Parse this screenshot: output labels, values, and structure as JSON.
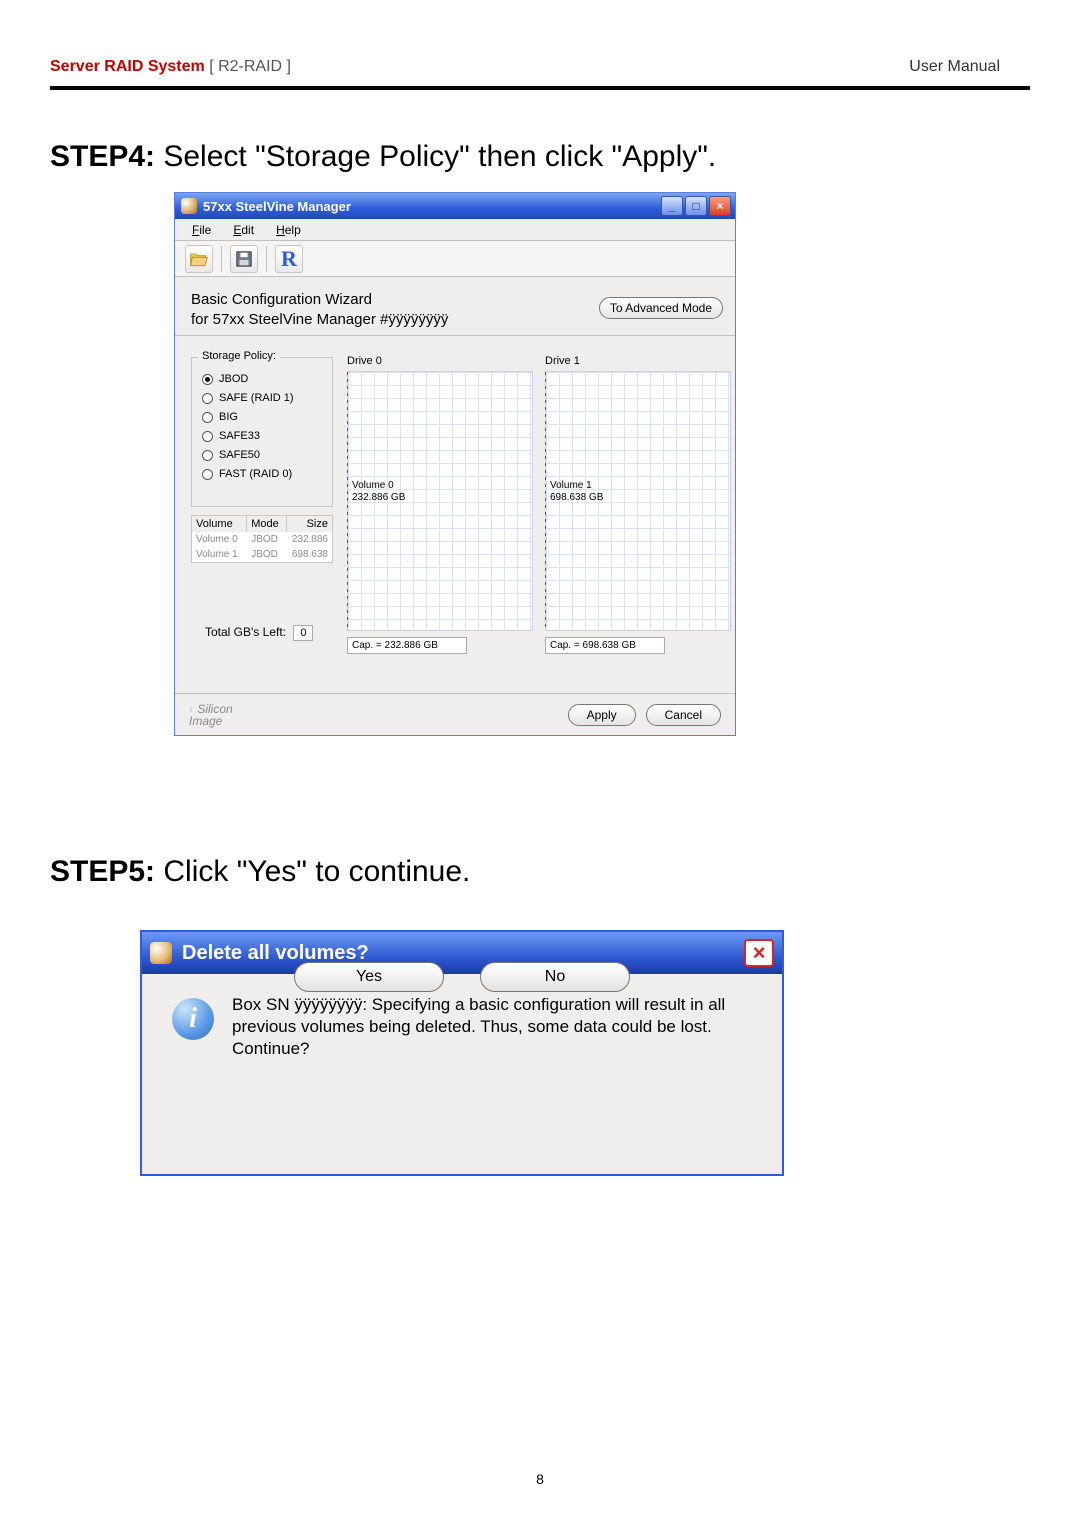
{
  "header": {
    "left_bold": "Server RAID System",
    "left_rest": " [ R2-RAID ]",
    "right": "User Manual"
  },
  "step4": {
    "bold": "STEP4:",
    "rest": " Select \"Storage Policy\" then click \"Apply\"."
  },
  "win1": {
    "title": "57xx SteelVine Manager",
    "min": "_",
    "max": "□",
    "close": "×",
    "menu": {
      "file_u": "F",
      "file_r": "ile",
      "edit_u": "E",
      "edit_r": "dit",
      "help_u": "H",
      "help_r": "elp"
    },
    "toolbar_r": "R",
    "wiz_title": "Basic Configuration Wizard",
    "wiz_sub": "for 57xx SteelVine Manager #ÿÿÿÿÿÿÿÿ",
    "adv": "To Advanced Mode",
    "policy_legend": "Storage Policy:",
    "policies": {
      "p0": "JBOD",
      "p1": "SAFE (RAID 1)",
      "p2": "BIG",
      "p3": "SAFE33",
      "p4": "SAFE50",
      "p5": "FAST (RAID 0)"
    },
    "table": {
      "h1": "Volume",
      "h2": "Mode",
      "h3": "Size",
      "r0c0": "Volume 0",
      "r0c1": "JBOD",
      "r0c2": "232.886",
      "r1c0": "Volume 1",
      "r1c1": "JBOD",
      "r1c2": "698.638"
    },
    "total_label": "Total GB's Left:",
    "total_val": "0",
    "drive0": {
      "label": "Drive 0",
      "vol": "Volume 0",
      "sz": "232.886 GB",
      "cap": "Cap. = 232.886 GB"
    },
    "drive1": {
      "label": "Drive 1",
      "vol": "Volume 1",
      "sz": "698.638 GB",
      "cap": "Cap. = 698.638 GB"
    },
    "brand1": "Silicon",
    "brand2": "Image",
    "apply": "Apply",
    "cancel": "Cancel"
  },
  "step5": {
    "bold": "STEP5:",
    "rest": " Click \"Yes\" to continue."
  },
  "win2": {
    "title": "Delete all volumes?",
    "close": "×",
    "info": "i",
    "text": "Box SN ÿÿÿÿÿÿÿÿ: Specifying a basic configuration will result in all previous volumes being deleted.  Thus, some data could be lost.  Continue?",
    "yes": "Yes",
    "no": "No"
  },
  "page_number": "8"
}
